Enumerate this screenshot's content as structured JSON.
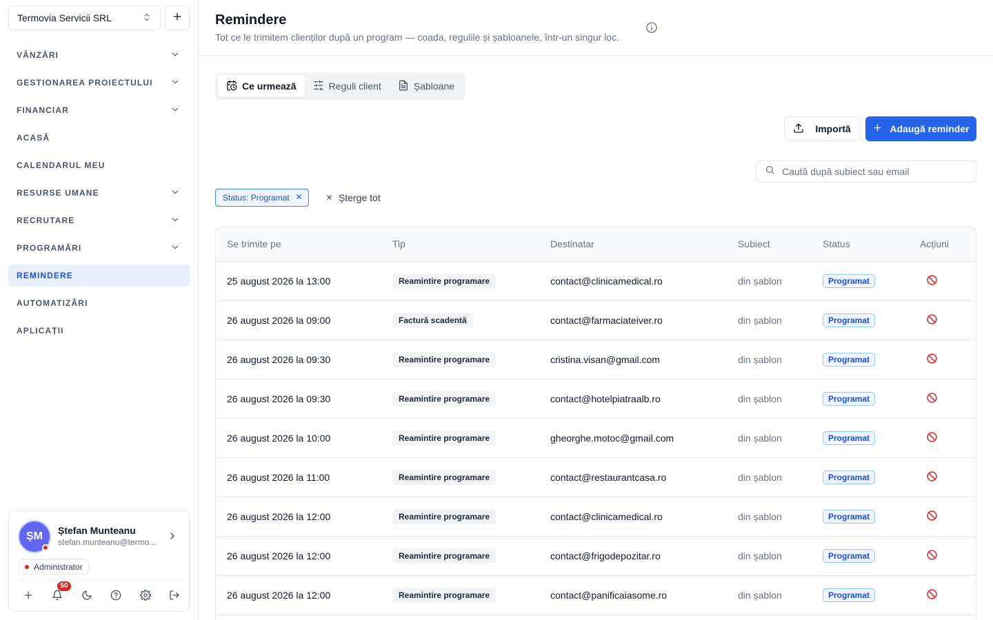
{
  "sidebar": {
    "org_name": "Termovia Servicii SRL",
    "nav": [
      {
        "label": "VÂNZĂRI",
        "chevron": true,
        "active": false
      },
      {
        "label": "GESTIONAREA PROIECTULUI",
        "chevron": true,
        "active": false
      },
      {
        "label": "FINANCIAR",
        "chevron": true,
        "active": false
      },
      {
        "label": "ACASĂ",
        "chevron": false,
        "active": false
      },
      {
        "label": "CALENDARUL MEU",
        "chevron": false,
        "active": false
      },
      {
        "label": "RESURSE UMANE",
        "chevron": true,
        "active": false
      },
      {
        "label": "RECRUTARE",
        "chevron": true,
        "active": false
      },
      {
        "label": "PROGRAMĂRI",
        "chevron": true,
        "active": false
      },
      {
        "label": "REMINDERE",
        "chevron": false,
        "active": true
      },
      {
        "label": "AUTOMATIZĂRI",
        "chevron": false,
        "active": false
      },
      {
        "label": "APLICAȚII",
        "chevron": false,
        "active": false
      }
    ],
    "user": {
      "initials": "ȘM",
      "name": "Ștefan Munteanu",
      "email": "stefan.munteanu@termo...",
      "role": "Administrator",
      "notifications": "50"
    }
  },
  "header": {
    "title": "Remindere",
    "subtitle": "Tot ce le trimitem clienților după un program — coada, regulile și șabloanele, într-un singur loc."
  },
  "tabs": [
    {
      "label": "Ce urmează",
      "icon": "calendar-clock-icon",
      "active": true
    },
    {
      "label": "Reguli client",
      "icon": "sliders-icon",
      "active": false
    },
    {
      "label": "Șabloane",
      "icon": "file-text-icon",
      "active": false
    }
  ],
  "actions": {
    "import_label": "Importă",
    "add_label": "Adaugă reminder"
  },
  "search": {
    "placeholder": "Caută după subiect sau email",
    "value": ""
  },
  "filters": {
    "chip_label": "Status: Programat",
    "clear_label": "Șterge tot"
  },
  "table": {
    "columns": [
      "Se trimite pe",
      "Tip",
      "Destinatar",
      "Subiect",
      "Status",
      "Acțiuni"
    ],
    "rows": [
      {
        "date": "25 august 2026 la 13:00",
        "type": "Reamintire programare",
        "recipient": "contact@clinicamedical.ro",
        "subject": "din șablon",
        "status": "Programat"
      },
      {
        "date": "26 august 2026 la 09:00",
        "type": "Factură scadentă",
        "recipient": "contact@farmaciateiver.ro",
        "subject": "din șablon",
        "status": "Programat"
      },
      {
        "date": "26 august 2026 la 09:30",
        "type": "Reamintire programare",
        "recipient": "cristina.visan@gmail.com",
        "subject": "din șablon",
        "status": "Programat"
      },
      {
        "date": "26 august 2026 la 09:30",
        "type": "Reamintire programare",
        "recipient": "contact@hotelpiatraalb.ro",
        "subject": "din șablon",
        "status": "Programat"
      },
      {
        "date": "26 august 2026 la 10:00",
        "type": "Reamintire programare",
        "recipient": "gheorghe.motoc@gmail.com",
        "subject": "din șablon",
        "status": "Programat"
      },
      {
        "date": "26 august 2026 la 11:00",
        "type": "Reamintire programare",
        "recipient": "contact@restaurantcasa.ro",
        "subject": "din șablon",
        "status": "Programat"
      },
      {
        "date": "26 august 2026 la 12:00",
        "type": "Reamintire programare",
        "recipient": "contact@clinicamedical.ro",
        "subject": "din șablon",
        "status": "Programat"
      },
      {
        "date": "26 august 2026 la 12:00",
        "type": "Reamintire programare",
        "recipient": "contact@frigodepozitar.ro",
        "subject": "din șablon",
        "status": "Programat"
      },
      {
        "date": "26 august 2026 la 12:00",
        "type": "Reamintire programare",
        "recipient": "contact@panificaiasome.ro",
        "subject": "din șablon",
        "status": "Programat"
      }
    ]
  },
  "colors": {
    "accent": "#2563eb",
    "active_nav_bg": "#e8effc",
    "danger": "#dc2626"
  }
}
